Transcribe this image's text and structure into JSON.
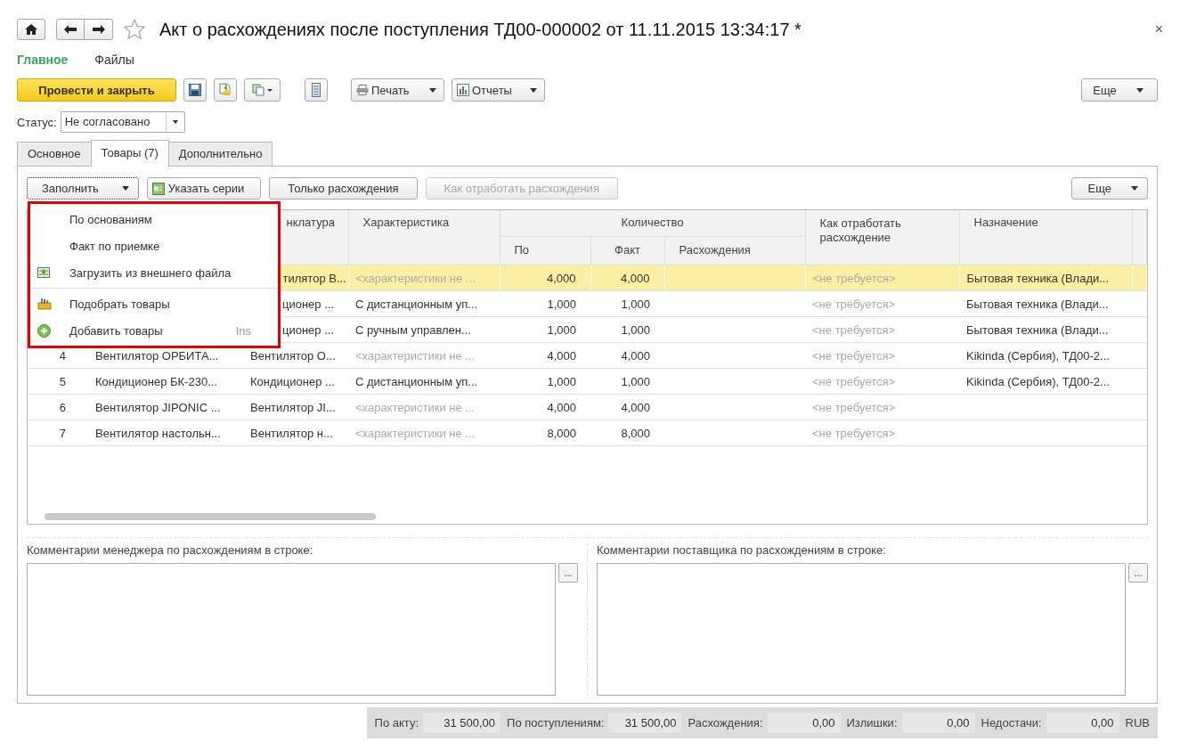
{
  "window": {
    "title": "Акт о расхождениях после поступления ТД00-000002 от 11.11.2015 13:34:17 *",
    "close": "×"
  },
  "sections": [
    {
      "label": "Главное",
      "selected": true
    },
    {
      "label": "Файлы",
      "selected": false
    }
  ],
  "command_bar": {
    "primary": "Провести и закрыть",
    "print": "Печать",
    "reports": "Отчеты",
    "more": "Еще"
  },
  "status": {
    "label": "Статус:",
    "value": "Не согласовано"
  },
  "tabs": [
    {
      "label": "Основное",
      "selected": false
    },
    {
      "label": "Товары (7)",
      "selected": true
    },
    {
      "label": "Дополнительно",
      "selected": false
    }
  ],
  "toolbar": {
    "buttons": [
      {
        "kind": "dropdown",
        "label": "Заполнить",
        "disabled": false
      },
      {
        "kind": "series",
        "label": "Указать серии",
        "disabled": false
      },
      {
        "kind": "plain",
        "label": "Только расхождения",
        "disabled": false
      },
      {
        "kind": "plain",
        "label": "Как отработать расхождения",
        "disabled": true
      }
    ],
    "more": "Еще"
  },
  "menu": [
    {
      "label": "По основаниям",
      "separator_above": false
    },
    {
      "label": "Факт по приемке",
      "separator_above": false
    },
    {
      "label": "Загрузить из внешнего файла",
      "separator_above": false
    },
    {
      "label": "Подобрать товары",
      "separator_above": true
    },
    {
      "label": "Добавить товары",
      "separator_above": false,
      "shortcut": "Ins"
    }
  ],
  "table": {
    "columns": {
      "nomenclature": "нклатура",
      "characteristic": "Характеристика",
      "quantity": "Количество",
      "qty_doc": "По",
      "qty_fact": "Факт",
      "qty_diff": "Расхождения",
      "handling": "Как отработать расхождение",
      "purpose": "Назначение"
    },
    "rows": [
      {
        "selected": true,
        "nomenclature": "тилятор В...",
        "characteristic": "<характеристики не ...",
        "characteristic_empty": true,
        "doc": "4,000",
        "fact": "4,000",
        "handling": "<не требуется>",
        "purpose": "Бытовая техника (Влади..."
      },
      {
        "selected": false,
        "nomenclature": "ционер ...",
        "characteristic": "С дистанционным уп...",
        "characteristic_empty": false,
        "doc": "1,000",
        "fact": "1,000",
        "handling": "<не требуется>",
        "purpose": "Бытовая техника (Влади..."
      },
      {
        "selected": false,
        "nomenclature": "ционер ...",
        "characteristic": "С ручным управлен...",
        "characteristic_empty": false,
        "doc": "1,000",
        "fact": "1,000",
        "handling": "<не требуется>",
        "purpose": "Бытовая техника (Влади..."
      },
      {
        "selected": false,
        "n": "4",
        "name": "Вентилятор ОРБИТА...",
        "nomenclature": "Вентилятор О...",
        "characteristic": "<характеристики не ...",
        "characteristic_empty": true,
        "doc": "4,000",
        "fact": "4,000",
        "handling": "<не требуется>",
        "purpose": "Kikinda (Сербия), ТД00-2..."
      },
      {
        "selected": false,
        "n": "5",
        "name": "Кондиционер БК-230...",
        "nomenclature": "Кондиционер ...",
        "characteristic": "С дистанционным уп...",
        "characteristic_empty": false,
        "doc": "1,000",
        "fact": "1,000",
        "handling": "<не требуется>",
        "purpose": "Kikinda (Сербия), ТД00-2..."
      },
      {
        "selected": false,
        "n": "6",
        "name": "Вентилятор JIPONIC ...",
        "nomenclature": "Вентилятор JI...",
        "characteristic": "<характеристики не ...",
        "characteristic_empty": true,
        "doc": "4,000",
        "fact": "4,000",
        "handling": "<не требуется>"
      },
      {
        "selected": false,
        "n": "7",
        "name": "Вентилятор настольн...",
        "nomenclature": "Вентилятор н...",
        "characteristic": "<характеристики не ...",
        "characteristic_empty": true,
        "doc": "8,000",
        "fact": "8,000",
        "handling": "<не требуется>"
      }
    ]
  },
  "comments": [
    {
      "label": "Комментарии менеджера по расхождениям в строке:",
      "button": "..."
    },
    {
      "label": "Комментарии поставщика по расхождениям в строке:",
      "button": "..."
    }
  ],
  "totals": [
    {
      "label": "По акту:",
      "value": "31 500,00"
    },
    {
      "label": "По поступлениям:",
      "value": "31 500,00"
    },
    {
      "label": "Расхождения:",
      "value": "0,00"
    },
    {
      "label": "Излишки:",
      "value": "0,00"
    },
    {
      "label": "Недостачи:",
      "value": "0,00"
    }
  ],
  "currency": "RUB"
}
